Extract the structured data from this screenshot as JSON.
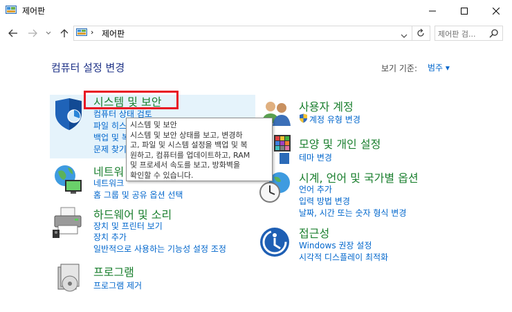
{
  "window": {
    "title": "제어판"
  },
  "address": {
    "path": "제어판",
    "separator": "›"
  },
  "search": {
    "placeholder": "제어판 검..."
  },
  "main": {
    "title": "컴퓨터 설정 변경",
    "view_by_label": "보기 기준:",
    "view_by_value": "범주",
    "view_by_arrow": "▾"
  },
  "categories": {
    "system_security": {
      "title": "시스템 및 보안",
      "links": [
        "컴퓨터 상태 검토",
        "파일 히스",
        "백업 및 복",
        "문제 찾기"
      ]
    },
    "network": {
      "title": "네트워",
      "links": [
        "네트워크",
        "홈 그룹 및 공유 옵션 선택"
      ]
    },
    "hardware": {
      "title": "하드웨어 및 소리",
      "links": [
        "장치 및 프린터 보기",
        "장치 추가",
        "일반적으로 사용하는 기능성 설정 조정"
      ]
    },
    "programs": {
      "title": "프로그램",
      "links": [
        "프로그램 제거"
      ]
    },
    "user_accounts": {
      "title": "사용자 계정",
      "links": [
        "계정 유형 변경"
      ]
    },
    "appearance": {
      "title": "모양 및 개인 설정",
      "links": [
        "테마 변경"
      ]
    },
    "clock": {
      "title": "시계, 언어 및 국가별 옵션",
      "links": [
        "언어 추가",
        "입력 방법 변경",
        "날짜, 시간 또는 숫자 형식 변경"
      ]
    },
    "ease": {
      "title": "접근성",
      "links": [
        "Windows 권장 설정",
        "시각적 디스플레이 최적화"
      ]
    }
  },
  "tooltip": {
    "title": "시스템 및 보안",
    "lines": [
      "시스템 및 보안 상태를 보고, 변경하",
      "고, 파일 및 시스템 설정을 백업 및 복",
      "원하고, 컴퓨터를 업데이트하고, RAM",
      "및 프로세서 속도를 보고, 방화벽을",
      "확인할 수 있습니다."
    ]
  },
  "colors": {
    "accent_link": "#0066cc",
    "category_title": "#1a7f2e",
    "highlight": "#e5f3fb",
    "focus_red": "#e81123"
  }
}
